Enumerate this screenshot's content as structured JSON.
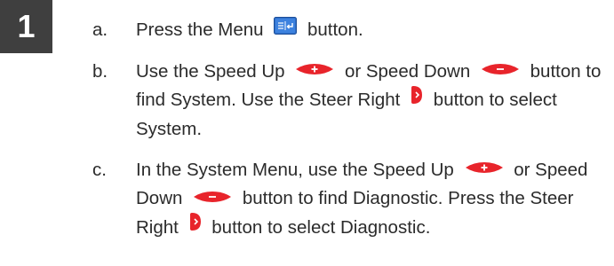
{
  "step": {
    "number": "1"
  },
  "items": [
    {
      "marker": "a.",
      "t1": "Press the Menu",
      "t2": "button."
    },
    {
      "marker": "b.",
      "t1": "Use the Speed Up",
      "t2": "or Speed Down",
      "t3": "button to find System. Use the Steer Right",
      "t4": "button to select System."
    },
    {
      "marker": "c.",
      "t1": "In the System Menu, use the Speed Up",
      "t2": "or Speed Down",
      "t3": "button to find Diagnostic. Press the Steer Right",
      "t4": "button to select Diagnostic."
    }
  ],
  "icons": {
    "menu": "menu-button-icon",
    "speed_up": "speed-up-button-icon",
    "speed_down": "speed-down-button-icon",
    "steer_right": "steer-right-button-icon"
  },
  "colors": {
    "button_red": "#e8242b",
    "menu_blue": "#2f6fc9",
    "badge": "#3f3f3f"
  }
}
